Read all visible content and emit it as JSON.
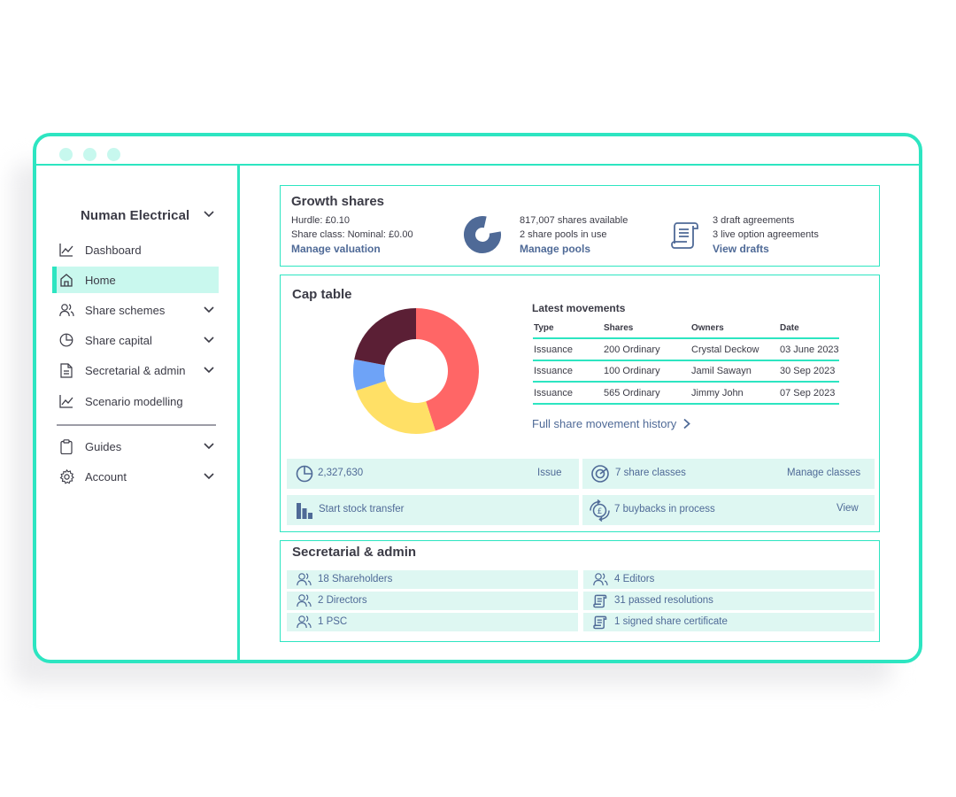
{
  "window": {
    "accent": "#2de5c1",
    "dots": [
      "#c7f8ee",
      "#c7f8ee",
      "#c7f8ee"
    ]
  },
  "sidebar": {
    "company": "Numan Electrical",
    "items": [
      {
        "label": "Dashboard",
        "icon": "line-chart-icon",
        "has_chevron": false,
        "active": false
      },
      {
        "label": "Home",
        "icon": "home-icon",
        "has_chevron": false,
        "active": true
      },
      {
        "label": "Share schemes",
        "icon": "users-icon",
        "has_chevron": true,
        "active": false
      },
      {
        "label": "Share capital",
        "icon": "pie-chart-icon",
        "has_chevron": true,
        "active": false
      },
      {
        "label": "Secretarial & admin",
        "icon": "document-icon",
        "has_chevron": true,
        "active": false
      },
      {
        "label": "Scenario modelling",
        "icon": "line-chart-icon",
        "has_chevron": false,
        "active": false
      }
    ],
    "bottom_items": [
      {
        "label": "Guides",
        "icon": "clipboard-icon",
        "has_chevron": true
      },
      {
        "label": "Account",
        "icon": "gear-icon",
        "has_chevron": true
      }
    ]
  },
  "growth_shares": {
    "title": "Growth shares",
    "hurdle": "Hurdle: £0.10",
    "share_class": "Share class: Nominal: £0.00",
    "manage_valuation": "Manage valuation",
    "shares_available": "817,007 shares available",
    "share_pools": "2 share pools in use",
    "manage_pools": "Manage pools",
    "draft_agreements": "3 draft agreements",
    "live_agreements": "3 live option agreements",
    "view_drafts": "View drafts"
  },
  "cap_table": {
    "title": "Cap table",
    "latest_movements": {
      "title": "Latest movements",
      "columns": [
        "Type",
        "Shares",
        "Owners",
        "Date"
      ],
      "rows": [
        [
          "Issuance",
          "200 Ordinary",
          "Crystal Deckow",
          "03 June 2023"
        ],
        [
          "Issuance",
          "100 Ordinary",
          "Jamil Sawayn",
          "30 Sep 2023"
        ],
        [
          "Issuance",
          "565 Ordinary",
          "Jimmy John",
          "07 Sep 2023"
        ]
      ]
    },
    "full_history_link": "Full share movement history",
    "tiles": {
      "total_shares": "2,327,630",
      "issue": "Issue",
      "share_classes": "7 share classes",
      "manage_classes": "Manage classes",
      "stock_transfer": "Start stock transfer",
      "buybacks": "7 buybacks in process",
      "view": "View"
    }
  },
  "secretarial": {
    "title": "Secretarial & admin",
    "left": [
      {
        "label": "18 Shareholders",
        "icon": "users-icon"
      },
      {
        "label": "2 Directors",
        "icon": "users-icon"
      },
      {
        "label": "1 PSC",
        "icon": "users-icon"
      }
    ],
    "right": [
      {
        "label": "4 Editors",
        "icon": "users-icon"
      },
      {
        "label": "31 passed resolutions",
        "icon": "scroll-icon"
      },
      {
        "label": "1 signed share certificate",
        "icon": "scroll-icon"
      }
    ]
  },
  "chart_data": {
    "type": "pie",
    "donut": true,
    "slices": [
      {
        "value": 45,
        "color": "#ff6666"
      },
      {
        "value": 25,
        "color": "#ffe066"
      },
      {
        "value": 8,
        "color": "#6ea3f7"
      },
      {
        "value": 22,
        "color": "#5b1f35"
      }
    ]
  }
}
